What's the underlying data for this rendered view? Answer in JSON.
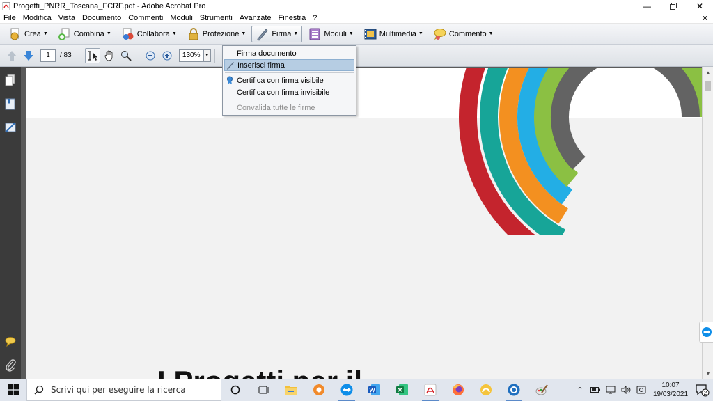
{
  "window": {
    "title": "Progetti_PNRR_Toscana_FCRF.pdf - Adobe Acrobat Pro",
    "minimize_icon": "minimize-icon",
    "restore_icon": "restore-icon",
    "close_icon": "close-icon"
  },
  "menubar": {
    "items": [
      "File",
      "Modifica",
      "Vista",
      "Documento",
      "Commenti",
      "Moduli",
      "Strumenti",
      "Avanzate",
      "Finestra",
      "?"
    ],
    "close_symbol": "×"
  },
  "toolbar": {
    "buttons": [
      {
        "label": "Crea",
        "icon": "create-pdf-icon"
      },
      {
        "label": "Combina",
        "icon": "combine-icon"
      },
      {
        "label": "Collabora",
        "icon": "collaborate-icon"
      },
      {
        "label": "Protezione",
        "icon": "lock-icon"
      },
      {
        "label": "Firma",
        "icon": "pen-icon"
      },
      {
        "label": "Moduli",
        "icon": "forms-icon"
      },
      {
        "label": "Multimedia",
        "icon": "film-icon"
      },
      {
        "label": "Commento",
        "icon": "comment-icon"
      }
    ],
    "active": "Firma"
  },
  "toolbar2": {
    "page_current": "1",
    "page_total": "/ 83",
    "zoom": "130%"
  },
  "firma_menu": {
    "items": [
      {
        "label": "Firma documento",
        "state": "normal"
      },
      {
        "label": "Inserisci firma",
        "state": "highlighted",
        "icon": "pen-icon"
      },
      {
        "label": "Certifica con firma visibile",
        "state": "normal",
        "icon": "ribbon-icon"
      },
      {
        "label": "Certifica con firma invisibile",
        "state": "normal"
      },
      {
        "label": "Convalida tutte le firme",
        "state": "disabled"
      }
    ]
  },
  "document": {
    "heading_partial": "I Progetti per il",
    "arc_colors": [
      "#c4242d",
      "#17a598",
      "#f39020",
      "#23aee5",
      "#8bc043",
      "#636363"
    ]
  },
  "taskbar": {
    "search_placeholder": "Scrivi qui per eseguire la ricerca",
    "time": "10:07",
    "date": "19/03/2021",
    "notification_count": "2"
  }
}
